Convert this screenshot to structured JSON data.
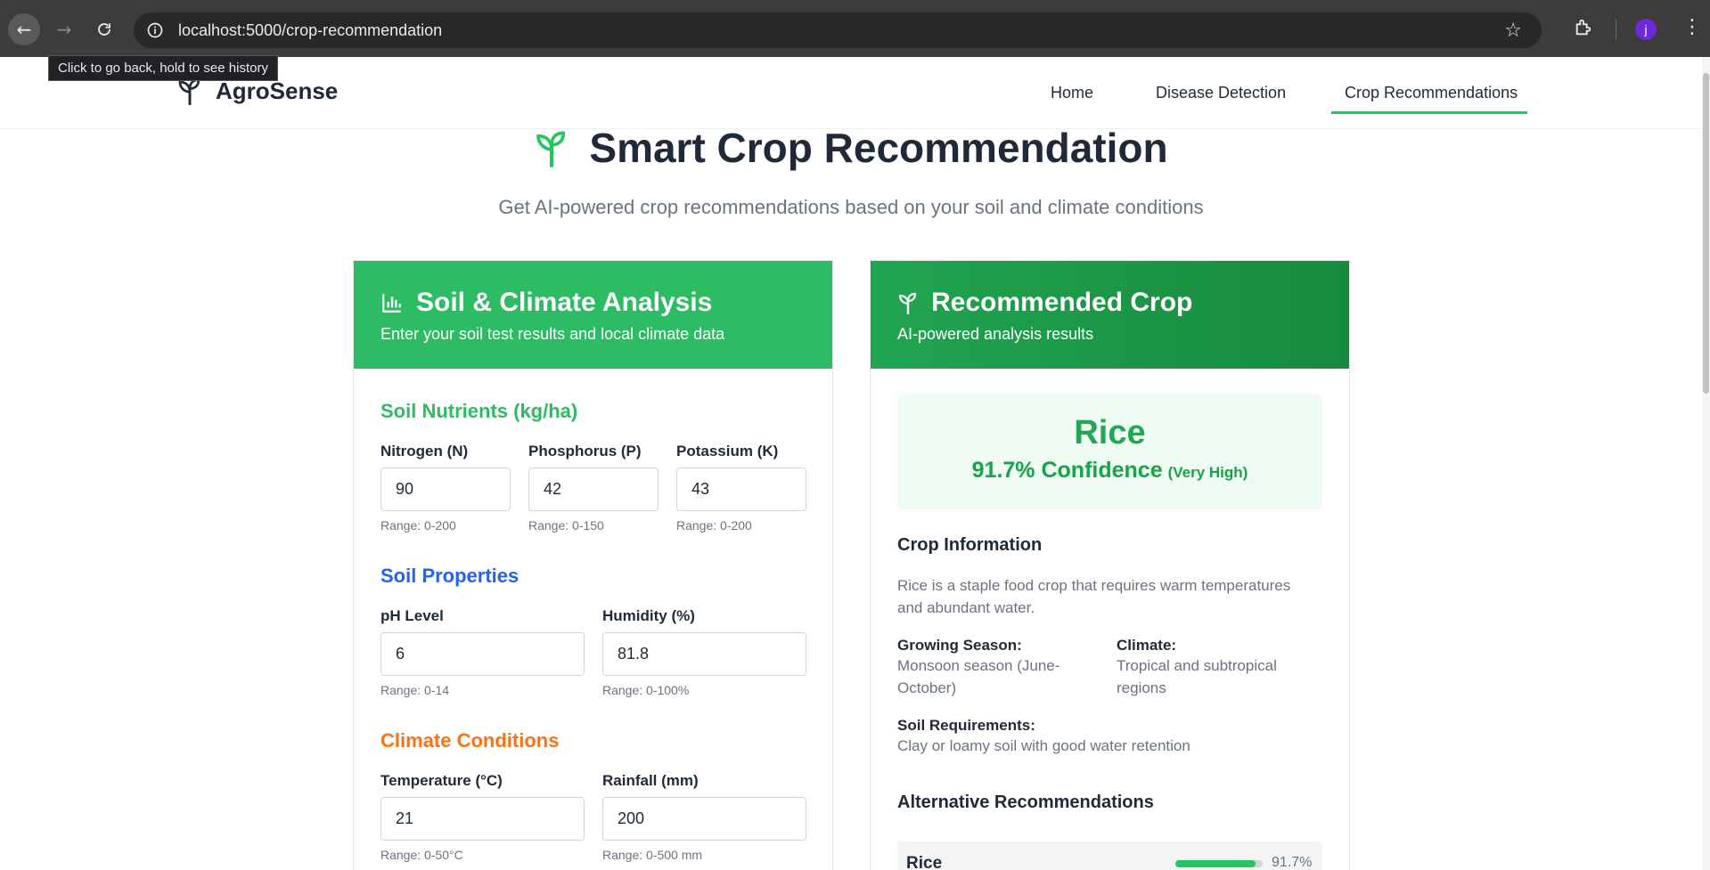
{
  "browser": {
    "url": "localhost:5000/crop-recommendation",
    "tooltip": "Click to go back, hold to see history",
    "profile_initial": "j"
  },
  "nav": {
    "brand": "AgroSense",
    "links": [
      "Home",
      "Disease Detection",
      "Crop Recommendations"
    ],
    "active": "Crop Recommendations"
  },
  "hero": {
    "title": "Smart Crop Recommendation",
    "subtitle": "Get AI-powered crop recommendations based on your soil and climate conditions"
  },
  "form": {
    "title": "Soil & Climate Analysis",
    "subtitle": "Enter your soil test results and local climate data",
    "nutrients": {
      "heading": "Soil Nutrients (kg/ha)",
      "nitrogen": {
        "label": "Nitrogen (N)",
        "value": "90",
        "hint": "Range: 0-200"
      },
      "phosphorus": {
        "label": "Phosphorus (P)",
        "value": "42",
        "hint": "Range: 0-150"
      },
      "potassium": {
        "label": "Potassium (K)",
        "value": "43",
        "hint": "Range: 0-200"
      }
    },
    "properties": {
      "heading": "Soil Properties",
      "ph": {
        "label": "pH Level",
        "value": "6",
        "hint": "Range: 0-14"
      },
      "humidity": {
        "label": "Humidity (%)",
        "value": "81.8",
        "hint": "Range: 0-100%"
      }
    },
    "climate": {
      "heading": "Climate Conditions",
      "temperature": {
        "label": "Temperature (°C)",
        "value": "21",
        "hint": "Range: 0-50°C"
      },
      "rainfall": {
        "label": "Rainfall (mm)",
        "value": "200",
        "hint": "Range: 0-500 mm"
      }
    }
  },
  "result": {
    "title": "Recommended Crop",
    "subtitle": "AI-powered analysis results",
    "crop": "Rice",
    "confidence": "91.7% Confidence",
    "confidence_level": "(Very High)",
    "info_heading": "Crop Information",
    "description": "Rice is a staple food crop that requires warm temperatures and abundant water.",
    "season_label": "Growing Season:",
    "season_value": "Monsoon season (June-October)",
    "climate_label": "Climate:",
    "climate_value": "Tropical and subtropical regions",
    "soil_label": "Soil Requirements:",
    "soil_value": "Clay or loamy soil with good water retention",
    "alt_heading": "Alternative Recommendations",
    "alternatives": [
      {
        "name": "Rice",
        "percent": "91.7%",
        "fraction": 0.917
      }
    ]
  },
  "colors": {
    "green": "#22c55e",
    "nutrients_heading": "#2dbb63",
    "properties_heading": "#2563eb",
    "climate_heading": "#f97316"
  }
}
